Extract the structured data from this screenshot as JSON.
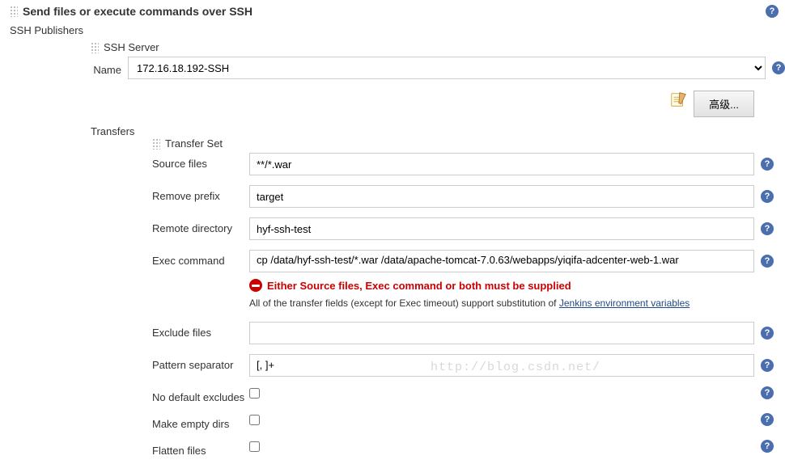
{
  "section": {
    "title": "Send files or execute commands over SSH"
  },
  "publishers": {
    "label": "SSH Publishers",
    "server": {
      "title": "SSH Server",
      "nameLabel": "Name",
      "nameValue": "172.16.18.192-SSH"
    },
    "toolbar": {
      "advancedLabel": "高级..."
    },
    "transfers": {
      "label": "Transfers",
      "setTitle": "Transfer Set",
      "fields": {
        "sourceFiles": {
          "label": "Source files",
          "value": "**/*.war"
        },
        "removePrefix": {
          "label": "Remove prefix",
          "value": "target"
        },
        "remoteDirectory": {
          "label": "Remote directory",
          "value": "hyf-ssh-test"
        },
        "execCommand": {
          "label": "Exec command",
          "value": "cp /data/hyf-ssh-test/*.war /data/apache-tomcat-7.0.63/webapps/yiqifa-adcenter-web-1.war"
        },
        "excludeFiles": {
          "label": "Exclude files",
          "value": ""
        },
        "patternSeparator": {
          "label": "Pattern separator",
          "value": "[, ]+"
        },
        "noDefaultExcludes": {
          "label": "No default excludes"
        },
        "makeEmptyDirs": {
          "label": "Make empty dirs"
        },
        "flattenFiles": {
          "label": "Flatten files"
        }
      },
      "error": "Either Source files, Exec command or both must be supplied",
      "hintPrefix": "All of the transfer fields (except for Exec timeout) support substitution of ",
      "hintLink": "Jenkins environment variables"
    }
  },
  "watermark": "http://blog.csdn.net/"
}
